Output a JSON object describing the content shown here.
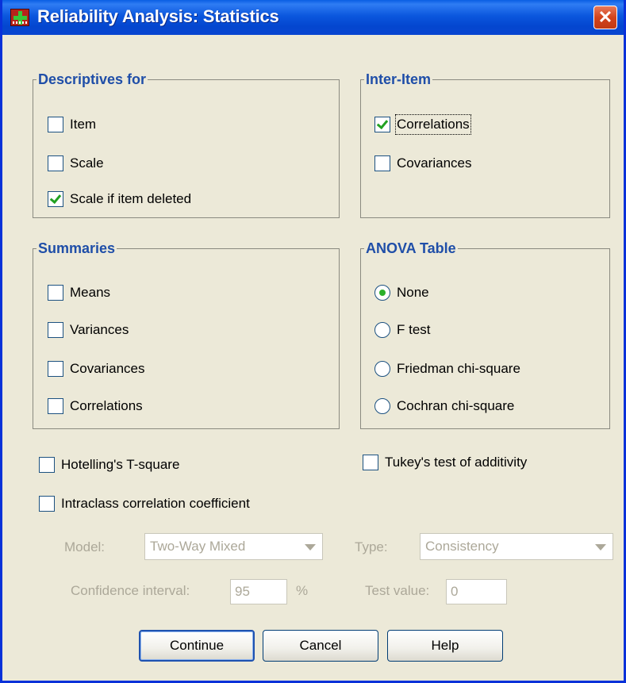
{
  "window": {
    "title": "Reliability Analysis: Statistics",
    "close_glyph": "✕"
  },
  "descriptives": {
    "legend": "Descriptives for",
    "items": [
      {
        "label": "Item",
        "checked": false
      },
      {
        "label": "Scale",
        "checked": false
      },
      {
        "label": "Scale if item deleted",
        "checked": true
      }
    ]
  },
  "inter_item": {
    "legend": "Inter-Item",
    "items": [
      {
        "label": "Correlations",
        "checked": true
      },
      {
        "label": "Covariances",
        "checked": false
      }
    ]
  },
  "summaries": {
    "legend": "Summaries",
    "items": [
      {
        "label": "Means",
        "checked": false
      },
      {
        "label": "Variances",
        "checked": false
      },
      {
        "label": "Covariances",
        "checked": false
      },
      {
        "label": "Correlations",
        "checked": false
      }
    ]
  },
  "anova": {
    "legend": "ANOVA Table",
    "options": [
      {
        "label": "None",
        "selected": true
      },
      {
        "label": "F test",
        "selected": false
      },
      {
        "label": "Friedman chi-square",
        "selected": false
      },
      {
        "label": "Cochran chi-square",
        "selected": false
      }
    ]
  },
  "options": {
    "hotelling": {
      "label": "Hotelling's T-square",
      "checked": false
    },
    "tukey": {
      "label": "Tukey's test of additivity",
      "checked": false
    },
    "intraclass": {
      "label": "Intraclass correlation coefficient",
      "checked": false
    }
  },
  "icc": {
    "model_label": "Model:",
    "model_value": "Two-Way Mixed",
    "type_label": "Type:",
    "type_value": "Consistency",
    "ci_label": "Confidence interval:",
    "ci_value": "95",
    "ci_unit": "%",
    "test_label": "Test value:",
    "test_value": "0"
  },
  "buttons": {
    "continue": "Continue",
    "cancel": "Cancel",
    "help": "Help"
  },
  "colors": {
    "titlebar": "#0a5ee4",
    "legend_text": "#1f4ea8",
    "dialog_bg": "#ece9d8",
    "check_mark": "#21a121",
    "disabled_text": "#aca899"
  }
}
